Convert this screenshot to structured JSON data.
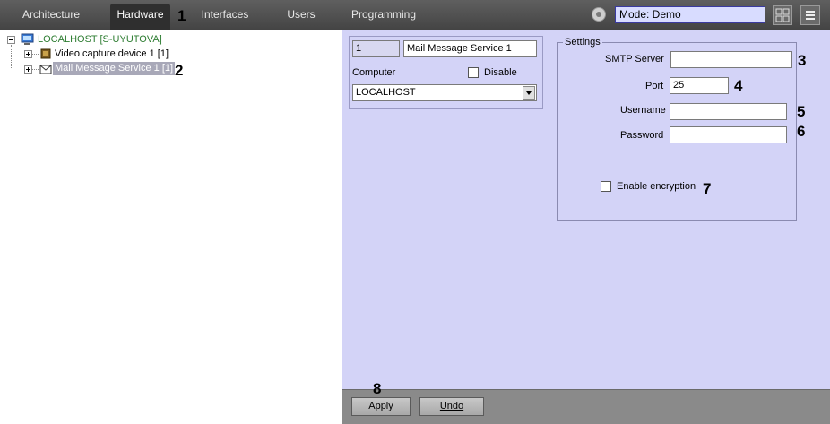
{
  "tabs": [
    {
      "label": "Architecture",
      "active": false
    },
    {
      "label": "Hardware",
      "active": true
    },
    {
      "label": "Interfaces",
      "active": false
    },
    {
      "label": "Users",
      "active": false
    },
    {
      "label": "Programming",
      "active": false
    }
  ],
  "mode": "Mode: Demo",
  "tree": {
    "root": "LOCALHOST [S-UYUTOVA]",
    "children": [
      "Video capture device 1 [1]",
      "Mail Message Service 1 [1]"
    ]
  },
  "object": {
    "id": "1",
    "name": "Mail Message Service 1",
    "computer_label": "Computer",
    "disable_label": "Disable",
    "computer_value": "LOCALHOST"
  },
  "settings": {
    "title": "Settings",
    "smtp_label": "SMTP Server",
    "smtp_value": "",
    "port_label": "Port",
    "port_value": "25",
    "username_label": "Username",
    "username_value": "",
    "password_label": "Password",
    "password_value": "",
    "encryption_label": "Enable encryption"
  },
  "buttons": {
    "apply": "Apply",
    "undo": "Undo"
  },
  "callouts": [
    "1",
    "2",
    "3",
    "4",
    "5",
    "6",
    "7",
    "8"
  ],
  "colors": {
    "panel": "#d3d3f7",
    "topbar": "#505050",
    "selection": "#a8a8b8",
    "root_text": "#2e7d32"
  }
}
